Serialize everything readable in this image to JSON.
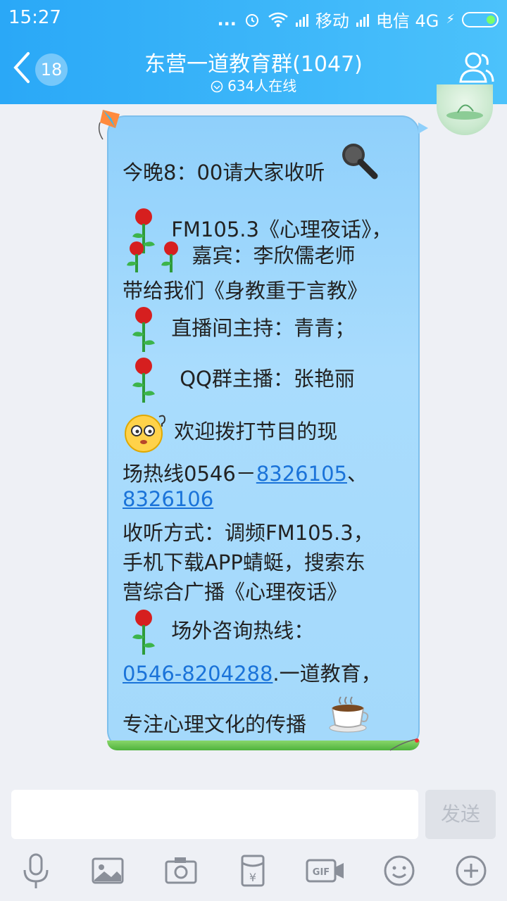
{
  "status_bar": {
    "time": "15:27",
    "dots": "...",
    "carrier1": "移动",
    "carrier2": "电信 4G"
  },
  "header": {
    "unread_count": "18",
    "title": "东营一道教育群(1047)",
    "online": "634人在线"
  },
  "message": {
    "lines": [
      "今晚8：00请大家收听",
      "FM105.3《心理夜话》，",
      "嘉宾：李欣儒老师",
      "带给我们《身教重于言教》",
      "直播间主持：青青；",
      "QQ群主播：张艳丽",
      "欢迎拨打节目的现",
      "场热线0546－",
      "8326105",
      "、",
      "8326106",
      "收听方式：调频FM105.3，",
      "手机下载APP蜻蜓，搜索东",
      "营综合广播《心理夜话》",
      "场外咨询热线：",
      "0546-8204288",
      ".一道教育，",
      "专注心理文化的传播"
    ]
  },
  "input": {
    "placeholder": "",
    "send_label": "发送"
  },
  "toolbar": {
    "icons": [
      "microphone-icon",
      "image-icon",
      "camera-icon",
      "red-packet-icon",
      "gif-icon",
      "emoji-icon",
      "plus-icon"
    ]
  },
  "colors": {
    "header_start": "#2aa8f7",
    "header_end": "#4cc2fb",
    "bubble": "#a4d9fb",
    "link": "#1a73d9"
  }
}
